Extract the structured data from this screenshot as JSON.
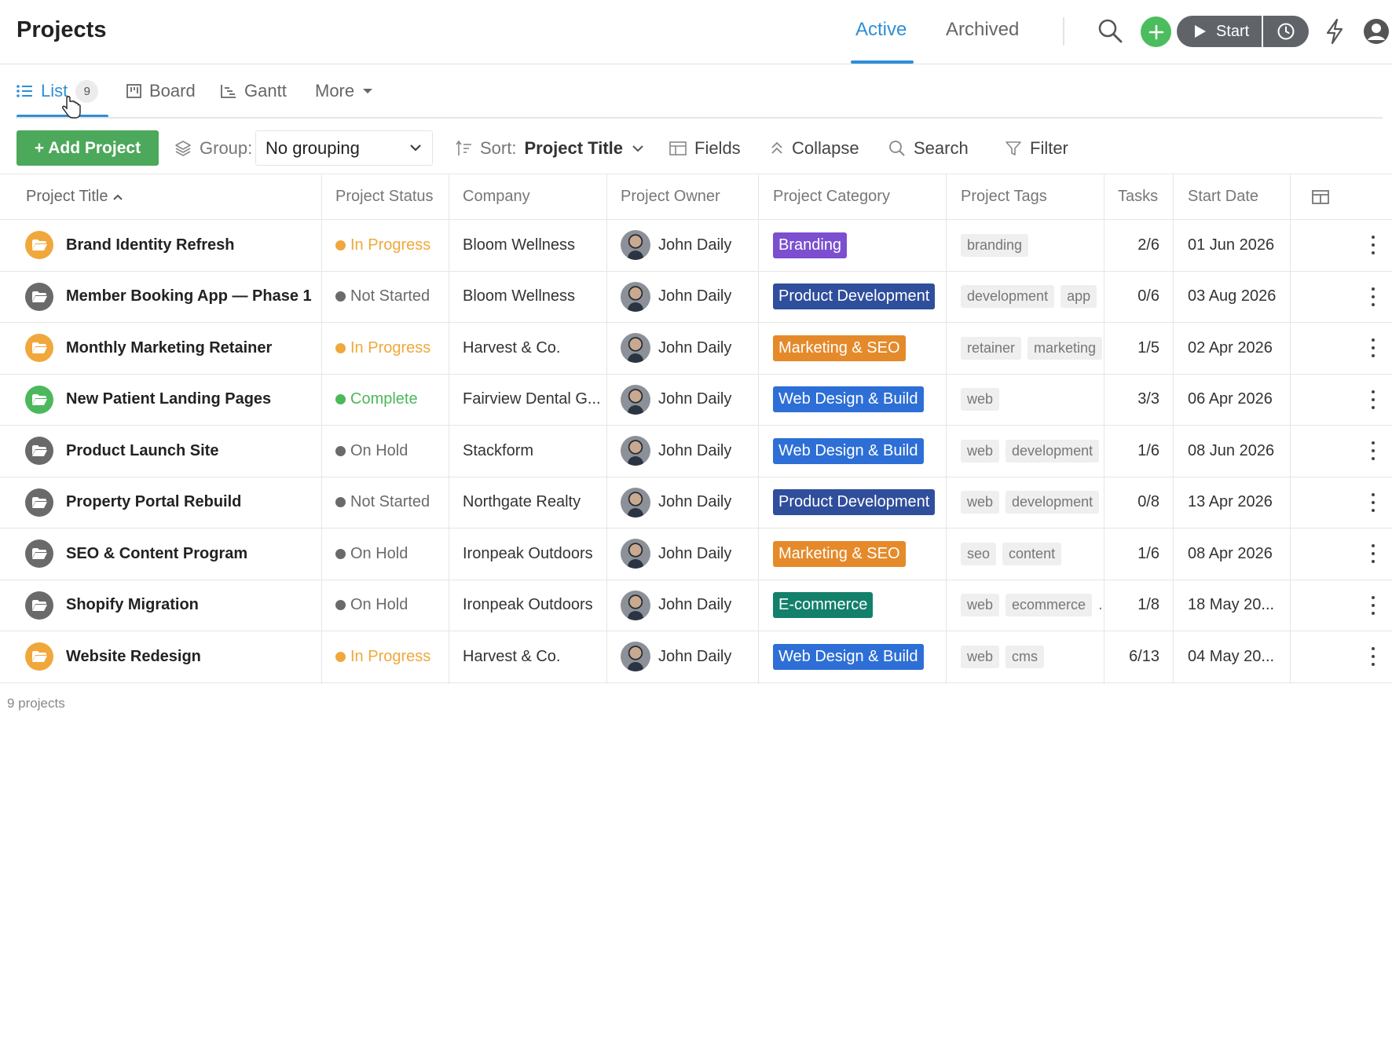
{
  "header": {
    "title": "Projects",
    "tabs": [
      {
        "label": "Active",
        "active": true
      },
      {
        "label": "Archived",
        "active": false
      }
    ],
    "timer": {
      "start_label": "Start"
    },
    "icons": [
      "search-icon",
      "plus-icon",
      "play-icon",
      "clock-icon",
      "lightning-icon",
      "user-icon"
    ]
  },
  "views": {
    "list": {
      "label": "List",
      "count": "9"
    },
    "board": {
      "label": "Board"
    },
    "gantt": {
      "label": "Gantt"
    },
    "more": {
      "label": "More"
    }
  },
  "toolbar": {
    "add_label": "+ Add Project",
    "group_label": "Group:",
    "group_value": "No grouping",
    "sort_label": "Sort:",
    "sort_value": "Project Title",
    "fields_label": "Fields",
    "collapse_label": "Collapse",
    "search_label": "Search",
    "filter_label": "Filter"
  },
  "table": {
    "headers": {
      "title": "Project Title",
      "status": "Project Status",
      "company": "Company",
      "owner": "Project Owner",
      "category": "Project Category",
      "tags": "Project Tags",
      "tasks": "Tasks",
      "start": "Start Date"
    },
    "rows": [
      {
        "title": "Brand Identity Refresh",
        "folder_color": "#f0a83c",
        "status": "In Progress",
        "status_color": "#f0a83c",
        "company": "Bloom Wellness",
        "owner": "John Daily",
        "category": "Branding",
        "category_color": "#7b4fcf",
        "tags": [
          "branding"
        ],
        "tags_overflow": false,
        "tasks": "2/6",
        "start": "01 Jun 2026"
      },
      {
        "title": "Member Booking App — Phase 1",
        "folder_color": "#6a6a6a",
        "status": "Not Started",
        "status_color": "#6a6a6a",
        "company": "Bloom Wellness",
        "owner": "John Daily",
        "category": "Product Development",
        "category_color": "#2f4e9c",
        "tags": [
          "development",
          "app"
        ],
        "tags_overflow": true,
        "tasks": "0/6",
        "start": "03 Aug 2026"
      },
      {
        "title": "Monthly Marketing Retainer",
        "folder_color": "#f0a83c",
        "status": "In Progress",
        "status_color": "#f0a83c",
        "company": "Harvest & Co.",
        "owner": "John Daily",
        "category": "Marketing & SEO",
        "category_color": "#e58a2a",
        "tags": [
          "retainer",
          "marketing"
        ],
        "tags_overflow": false,
        "tasks": "1/5",
        "start": "02 Apr 2026"
      },
      {
        "title": "New Patient Landing Pages",
        "folder_color": "#4cb85c",
        "status": "Complete",
        "status_color": "#4cb85c",
        "company": "Fairview Dental G...",
        "owner": "John Daily",
        "category": "Web Design & Build",
        "category_color": "#2d6fd6",
        "tags": [
          "web"
        ],
        "tags_overflow": false,
        "tasks": "3/3",
        "start": "06 Apr 2026"
      },
      {
        "title": "Product Launch Site",
        "folder_color": "#6a6a6a",
        "status": "On Hold",
        "status_color": "#6a6a6a",
        "company": "Stackform",
        "owner": "John Daily",
        "category": "Web Design & Build",
        "category_color": "#2d6fd6",
        "tags": [
          "web",
          "development"
        ],
        "tags_overflow": true,
        "tasks": "1/6",
        "start": "08 Jun 2026"
      },
      {
        "title": "Property Portal Rebuild",
        "folder_color": "#6a6a6a",
        "status": "Not Started",
        "status_color": "#6a6a6a",
        "company": "Northgate Realty",
        "owner": "John Daily",
        "category": "Product Development",
        "category_color": "#2f4e9c",
        "tags": [
          "web",
          "development"
        ],
        "tags_overflow": true,
        "tasks": "0/8",
        "start": "13 Apr 2026"
      },
      {
        "title": "SEO & Content Program",
        "folder_color": "#6a6a6a",
        "status": "On Hold",
        "status_color": "#6a6a6a",
        "company": "Ironpeak Outdoors",
        "owner": "John Daily",
        "category": "Marketing & SEO",
        "category_color": "#e58a2a",
        "tags": [
          "seo",
          "content"
        ],
        "tags_overflow": false,
        "tasks": "1/6",
        "start": "08 Apr 2026"
      },
      {
        "title": "Shopify Migration",
        "folder_color": "#6a6a6a",
        "status": "On Hold",
        "status_color": "#6a6a6a",
        "company": "Ironpeak Outdoors",
        "owner": "John Daily",
        "category": "E-commerce",
        "category_color": "#13806b",
        "tags": [
          "web",
          "ecommerce"
        ],
        "tags_overflow": true,
        "tasks": "1/8",
        "start": "18 May 20..."
      },
      {
        "title": "Website Redesign",
        "folder_color": "#f0a83c",
        "status": "In Progress",
        "status_color": "#f0a83c",
        "company": "Harvest & Co.",
        "owner": "John Daily",
        "category": "Web Design & Build",
        "category_color": "#2d6fd6",
        "tags": [
          "web",
          "cms"
        ],
        "tags_overflow": false,
        "tasks": "6/13",
        "start": "04 May 20..."
      }
    ],
    "footer": "9 projects"
  },
  "colors": {
    "accent": "#2f8fd6",
    "add_button": "#4ca85a",
    "plus_button": "#4cbd5e",
    "timer": "#606469"
  }
}
